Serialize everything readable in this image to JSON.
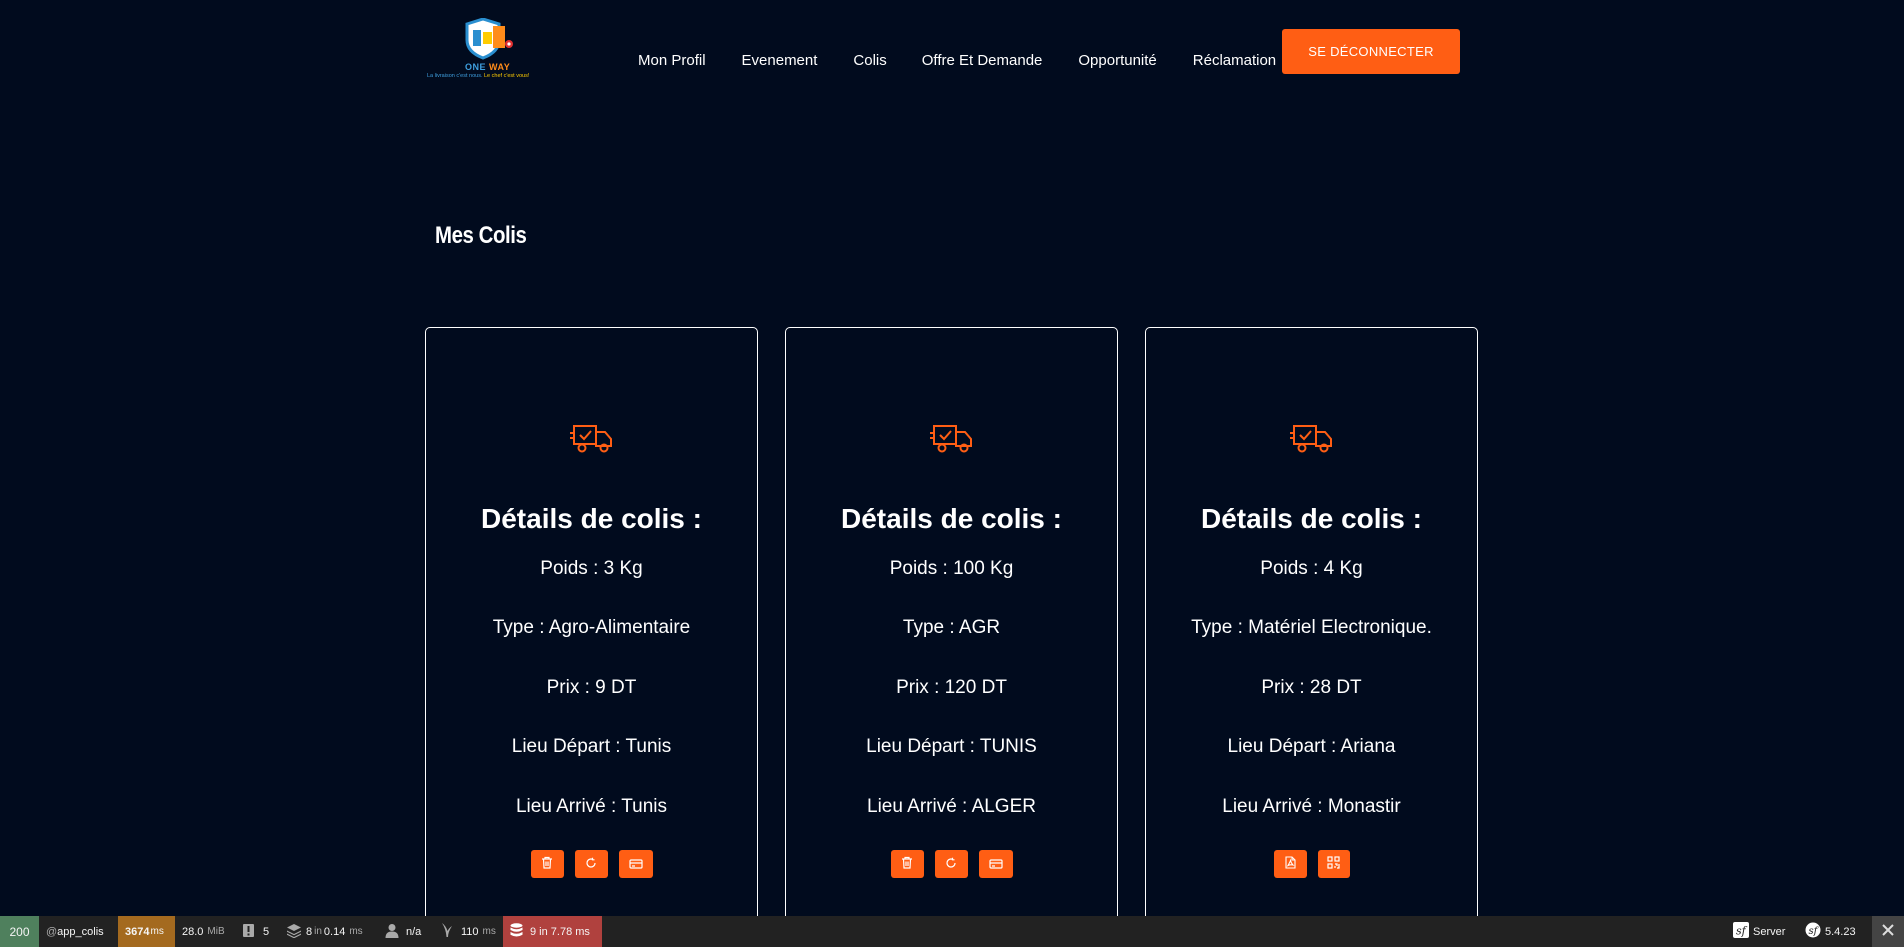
{
  "header": {
    "logo": {
      "brand_one": "ONE",
      "brand_way": "WAY",
      "tagline_a": "La livraison c'est nous.",
      "tagline_b": "Le chef c'est vous!"
    },
    "nav": [
      {
        "label": "Mon Profil"
      },
      {
        "label": "Evenement"
      },
      {
        "label": "Colis"
      },
      {
        "label": "Offre Et Demande"
      },
      {
        "label": "Opportunité"
      },
      {
        "label": "Réclamation"
      }
    ],
    "logout_label": "SE DÉCONNECTER"
  },
  "page_title": "Mes Colis",
  "cards": [
    {
      "title": "Détails de colis :",
      "poids": "Poids : 3 Kg",
      "type": "Type : Agro-Alimentaire",
      "prix": "Prix : 9 DT",
      "depart": "Lieu Départ : Tunis",
      "arrive": "Lieu Arrivé : Tunis",
      "actions": [
        "trash-icon",
        "refresh-icon",
        "card-icon"
      ]
    },
    {
      "title": "Détails de colis :",
      "poids": "Poids : 100 Kg",
      "type": "Type : AGR",
      "prix": "Prix : 120 DT",
      "depart": "Lieu Départ : TUNIS",
      "arrive": "Lieu Arrivé : ALGER",
      "actions": [
        "trash-icon",
        "refresh-icon",
        "card-icon"
      ]
    },
    {
      "title": "Détails de colis :",
      "poids": "Poids : 4 Kg",
      "type": "Type : Matériel Electronique.",
      "prix": "Prix : 28 DT",
      "depart": "Lieu Départ : Ariana",
      "arrive": "Lieu Arrivé : Monastir",
      "actions": [
        "pdf-icon",
        "qrcode-icon"
      ]
    }
  ],
  "toolbar": {
    "status": "200",
    "route_prefix": "@",
    "route": "app_colis",
    "time": "3674",
    "time_unit": "ms",
    "memory": "28.0",
    "memory_unit": "MiB",
    "logs": "5",
    "cache_count": "8",
    "cache_in": "in",
    "cache_time": "0.14",
    "cache_unit": "ms",
    "user": "n/a",
    "twig_time": "110",
    "twig_unit": "ms",
    "db": "9 in 7.78 ms",
    "server_label": "Server",
    "version": "5.4.23",
    "colors": {
      "status_bg": "#4f805d",
      "time_bg": "#a46a1f",
      "db_bg": "#b0413e"
    }
  },
  "colors": {
    "background": "#010b1e",
    "accent": "#ff5e14"
  }
}
